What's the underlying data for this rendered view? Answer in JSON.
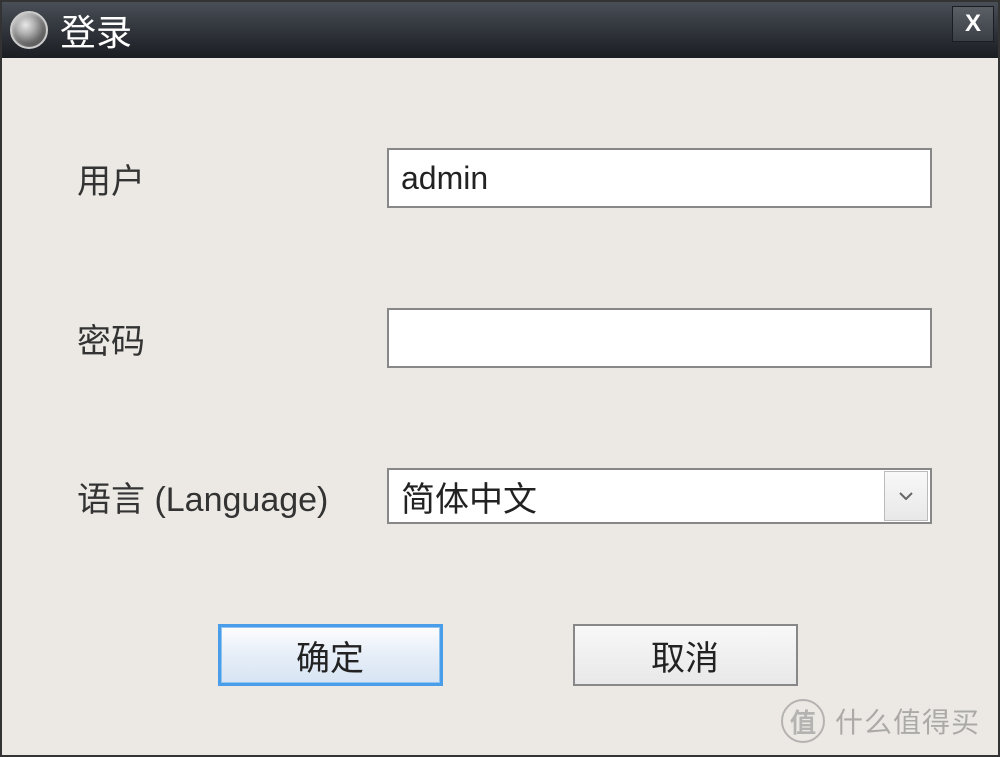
{
  "window": {
    "title": "登录",
    "close_label": "X"
  },
  "form": {
    "username": {
      "label": "用户",
      "value": "admin"
    },
    "password": {
      "label": "密码",
      "value": ""
    },
    "language": {
      "label": "语言 (Language)",
      "value": "简体中文"
    }
  },
  "buttons": {
    "ok": "确定",
    "cancel": "取消"
  },
  "watermark": {
    "icon": "值",
    "text": "什么值得买"
  }
}
